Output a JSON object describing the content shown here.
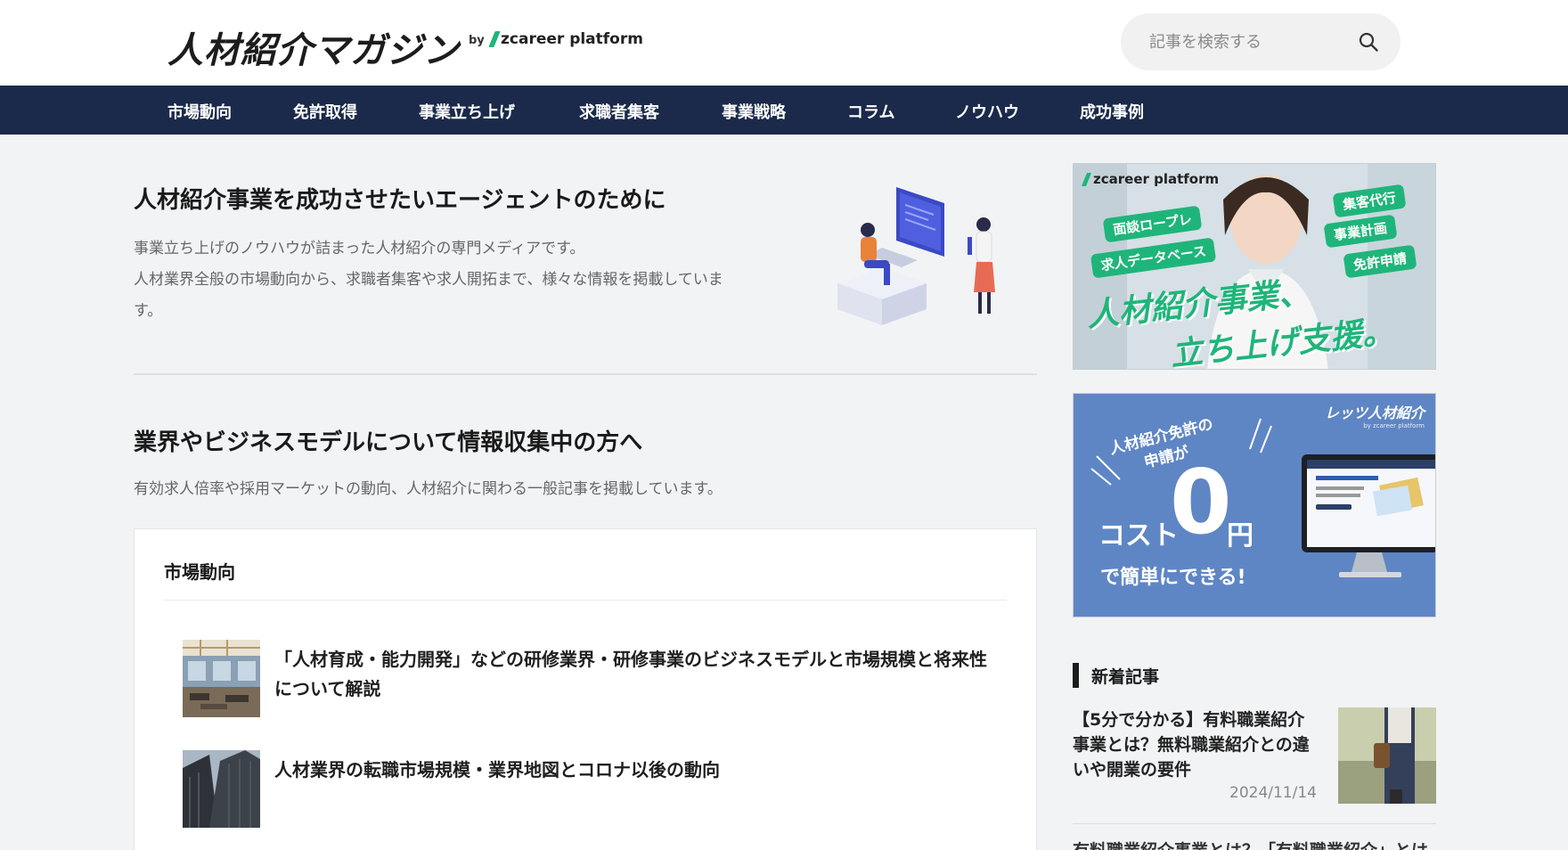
{
  "header": {
    "logo": "人材紹介マガジン",
    "by": "by",
    "platform": "zcareer platform",
    "search_placeholder": "記事を検索する"
  },
  "nav": {
    "items": [
      {
        "label": "市場動向"
      },
      {
        "label": "免許取得"
      },
      {
        "label": "事業立ち上げ"
      },
      {
        "label": "求職者集客"
      },
      {
        "label": "事業戦略"
      },
      {
        "label": "コラム"
      },
      {
        "label": "ノウハウ"
      },
      {
        "label": "成功事例"
      }
    ]
  },
  "hero": {
    "title": "人材紹介事業を成功させたいエージェントのために",
    "desc1": "事業立ち上げのノウハウが詰まった人材紹介の専門メディアです。",
    "desc2": "人材業界全般の市場動向から、求職者集客や求人開拓まで、様々な情報を掲載していま",
    "desc3": "す。"
  },
  "section": {
    "title": "業界やビジネスモデルについて情報収集中の方へ",
    "desc": "有効求人倍率や採用マーケットの動向、人材紹介に関わる一般記事を掲載しています。"
  },
  "card": {
    "title": "市場動向",
    "articles": [
      {
        "title": "「人材育成・能力開発」などの研修業界・研修事業のビジネスモデルと市場規模と将来性について解説"
      },
      {
        "title": "人材業界の転職市場規模・業界地図とコロナ以後の動向"
      }
    ]
  },
  "banner1": {
    "brand": "zcareer platform",
    "tags": [
      "面談ロープレ",
      "求人データベース",
      "集客代行",
      "事業計画",
      "免許申請"
    ],
    "line1": "人材紹介事業、",
    "line2": "立ち上げ支援。"
  },
  "banner2": {
    "brand": "レッツ人材紹介",
    "brand_sub": "by zcareer platform",
    "line1": "人材紹介免許の",
    "line2": "申請が",
    "cost": "コスト",
    "zero": "0",
    "yen": "円",
    "line3": "で簡単にできる!"
  },
  "sidebar": {
    "new_heading": "新着記事",
    "article": {
      "title": "【5分で分かる】有料職業紹介事業とは？無料職業紹介との違いや開業の要件",
      "date": "2024/11/14"
    },
    "next_title": "有料職業紹介事業とは？「有料職業紹介」とは"
  },
  "colors": {
    "nav_bg": "#1b2a4a",
    "accent_green": "#1fb57a",
    "banner_blue": "#5f86c4"
  }
}
